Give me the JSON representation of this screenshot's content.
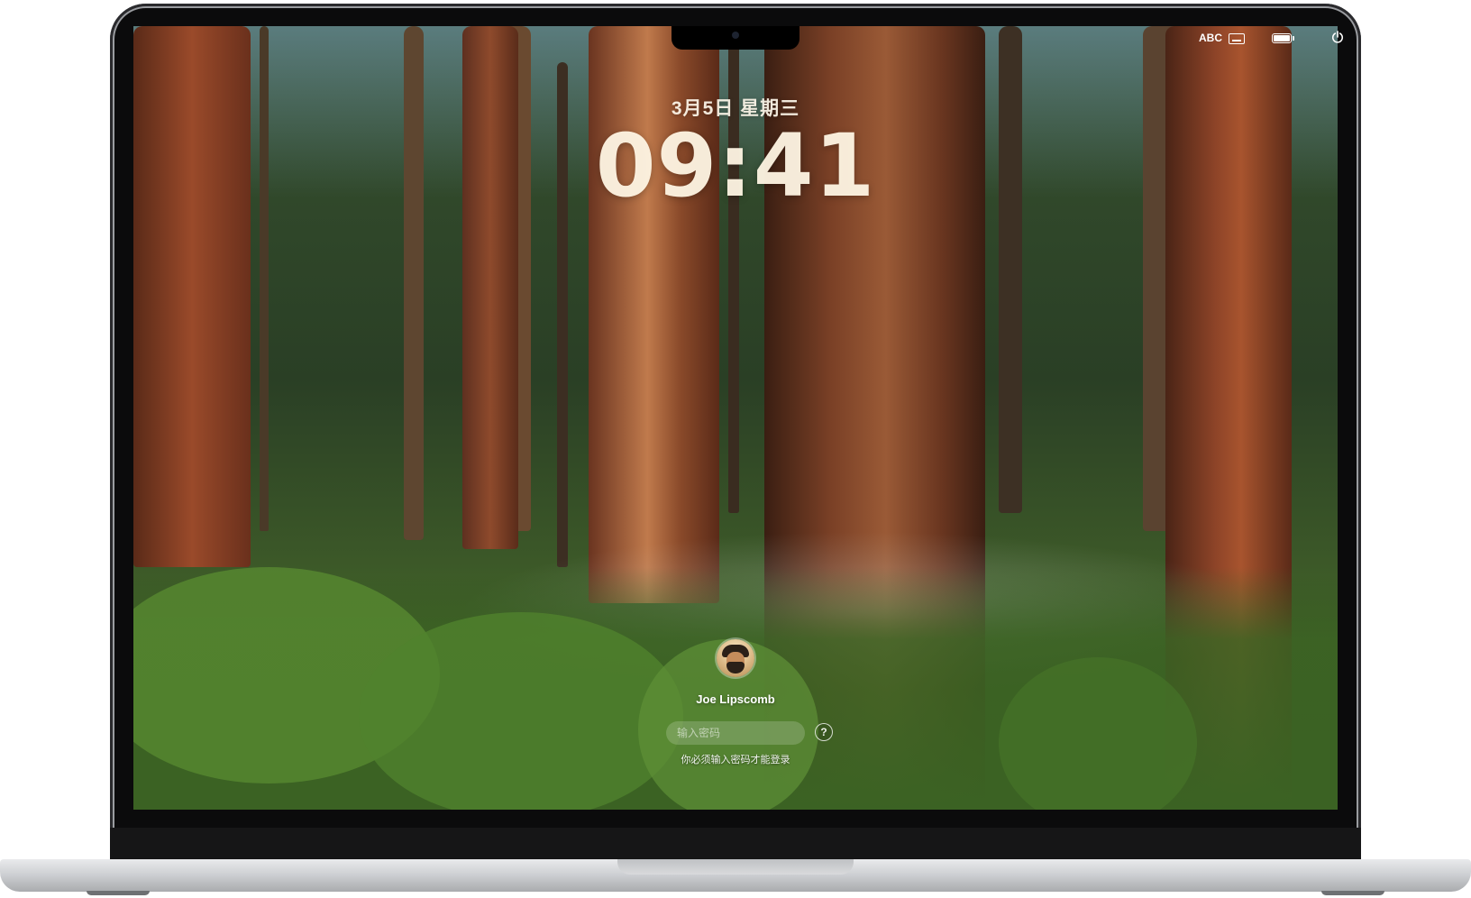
{
  "status_bar": {
    "input_source": "ABC",
    "keyboard_icon": "keyboard-icon",
    "battery_icon": "battery-icon",
    "power_icon": "power-icon"
  },
  "lock_screen": {
    "date": "3月5日 星期三",
    "time": "09:41",
    "user_name": "Joe Lipscomb",
    "password_placeholder": "输入密码",
    "help_label": "?",
    "hint": "你必须输入密码才能登录"
  },
  "colors": {
    "text": "#ffffff",
    "clock": "#fff6e4"
  }
}
